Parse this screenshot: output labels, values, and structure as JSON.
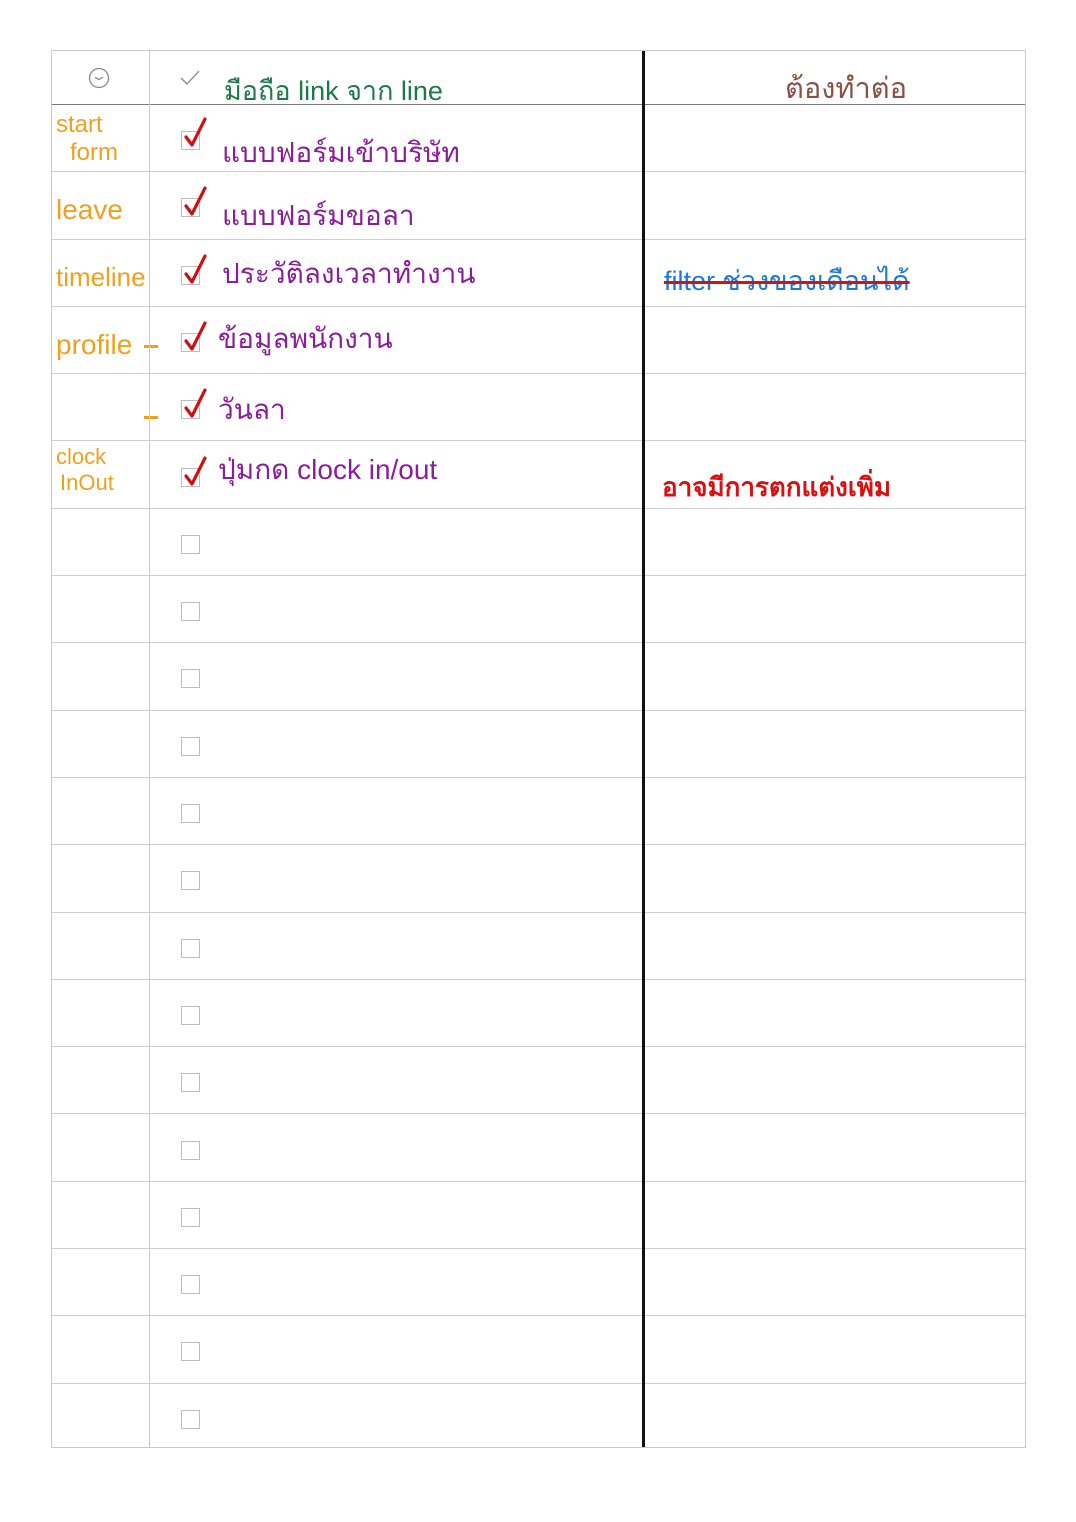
{
  "header": {
    "clock_icon": "clock-icon",
    "check_icon": "check-icon",
    "title": "มือถือ link จาก line",
    "todo_title": "ต้องทำต่อ"
  },
  "colors": {
    "tag": "#f0a020",
    "task": "#8a1d99",
    "header_title": "#1d7a4a",
    "todo_title": "#8b5045",
    "tick": "#d01010",
    "note_blue": "#1a7ad8",
    "note_red": "#d81010",
    "divider": "#111111"
  },
  "rows": [
    {
      "tag_line1": "start",
      "tag_line2": "form",
      "done": true,
      "task": "แบบฟอร์มเข้าบริษัท",
      "note": ""
    },
    {
      "tag_line1": "leave",
      "tag_line2": "",
      "done": true,
      "task": "แบบฟอร์มขอลา",
      "note": ""
    },
    {
      "tag_line1": "timeline",
      "tag_line2": "",
      "done": true,
      "task": "ประวัติลงเวลาทำงาน",
      "note": "filter ช่วงของเดือนได้",
      "note_struck": true
    },
    {
      "tag_line1": "profile",
      "tag_line2": "",
      "done": true,
      "task": "ข้อมูลพนักงาน",
      "note": ""
    },
    {
      "tag_line1": "",
      "tag_line2": "",
      "done": true,
      "task": "วันลา",
      "note": ""
    },
    {
      "tag_line1": "clock",
      "tag_line2": "InOut",
      "done": true,
      "task": "ปุ่มกด clock in/out",
      "note": "อาจมีการตกแต่งเพิ่ม"
    },
    {
      "done": false
    },
    {
      "done": false
    },
    {
      "done": false
    },
    {
      "done": false
    },
    {
      "done": false
    },
    {
      "done": false
    },
    {
      "done": false
    },
    {
      "done": false
    },
    {
      "done": false
    },
    {
      "done": false
    },
    {
      "done": false
    },
    {
      "done": false
    },
    {
      "done": false
    },
    {
      "done": false
    }
  ]
}
